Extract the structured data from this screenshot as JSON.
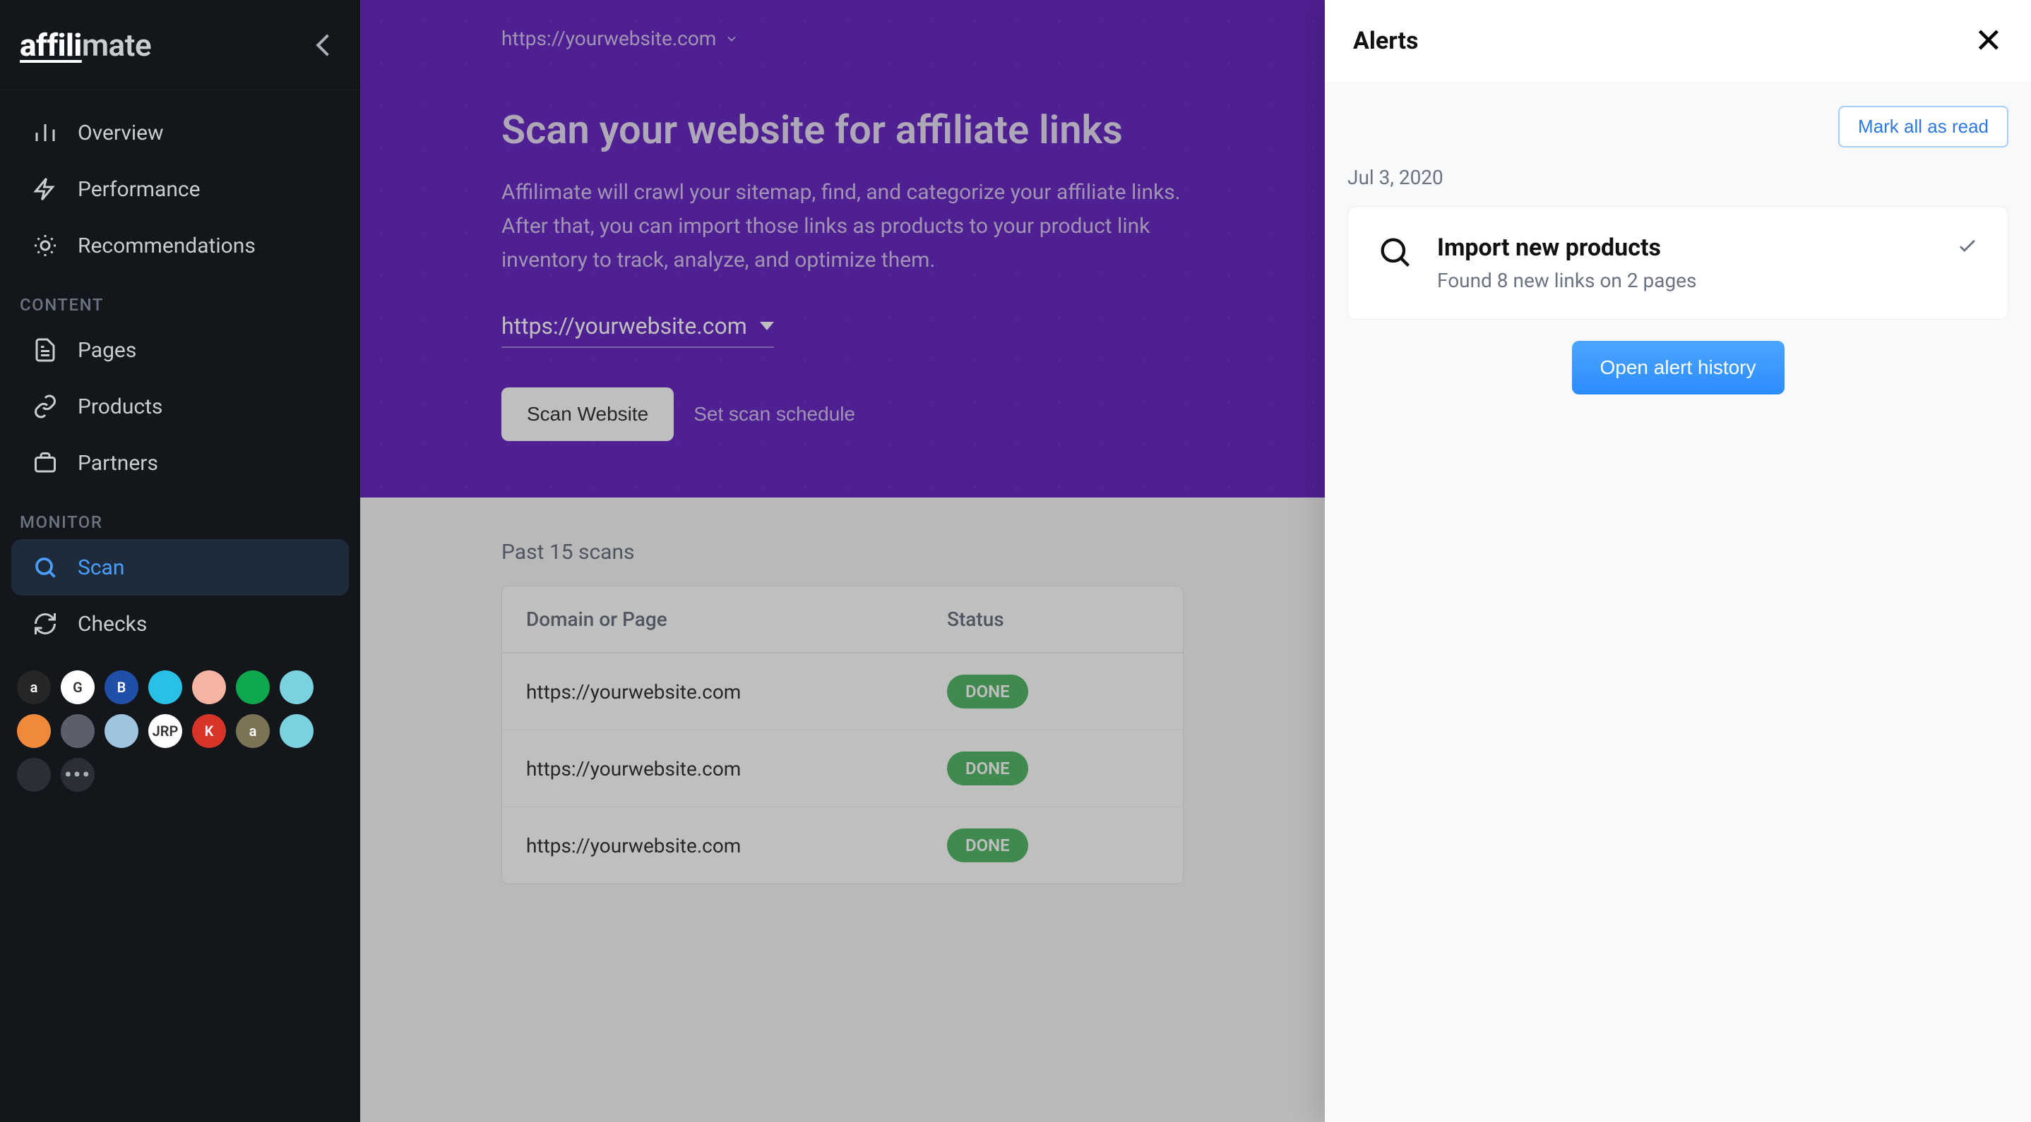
{
  "brand": {
    "part1": "affili",
    "part2": "mate"
  },
  "sidebar": {
    "items": [
      {
        "label": "Overview"
      },
      {
        "label": "Performance"
      },
      {
        "label": "Recommendations"
      }
    ],
    "sections": {
      "content": {
        "title": "CONTENT",
        "items": [
          {
            "label": "Pages"
          },
          {
            "label": "Products"
          },
          {
            "label": "Partners"
          }
        ]
      },
      "monitor": {
        "title": "MONITOR",
        "items": [
          {
            "label": "Scan"
          },
          {
            "label": "Checks"
          }
        ]
      }
    },
    "partner_badges": [
      {
        "initial": "a",
        "bg": "#262626"
      },
      {
        "initial": "G",
        "bg": "#ffffff"
      },
      {
        "initial": "B",
        "bg": "#1f4fa8"
      },
      {
        "initial": "",
        "bg": "#29c0e7"
      },
      {
        "initial": "",
        "bg": "#f5b4a4"
      },
      {
        "initial": "",
        "bg": "#0ea84f"
      },
      {
        "initial": "",
        "bg": "#7cd1e0"
      },
      {
        "initial": "",
        "bg": "#f08a3a"
      },
      {
        "initial": "",
        "bg": "#5a5f6b"
      },
      {
        "initial": "",
        "bg": "#9fc4e0"
      },
      {
        "initial": "JRP",
        "bg": "#ffffff"
      },
      {
        "initial": "K",
        "bg": "#d8352a"
      },
      {
        "initial": "a",
        "bg": "#7c7255"
      },
      {
        "initial": "",
        "bg": "#7cd1e0"
      },
      {
        "initial": "",
        "bg": "#2a2f37"
      }
    ]
  },
  "hero": {
    "site_top": "https://yourwebsite.com",
    "title": "Scan your website for affiliate links",
    "description": "Affilimate will crawl your sitemap, find, and categorize your affiliate links. After that, you can import those links as products to your product link inventory to track, analyze, and optimize them.",
    "site_select": "https://yourwebsite.com",
    "scan_button": "Scan Website",
    "schedule_button": "Set scan schedule"
  },
  "scans": {
    "title": "Past 15 scans",
    "columns": {
      "domain": "Domain or Page",
      "status": "Status"
    },
    "rows": [
      {
        "domain": "https://yourwebsite.com",
        "status": "DONE"
      },
      {
        "domain": "https://yourwebsite.com",
        "status": "DONE"
      },
      {
        "domain": "https://yourwebsite.com",
        "status": "DONE"
      }
    ]
  },
  "alerts": {
    "title": "Alerts",
    "mark_all": "Mark all as read",
    "date": "Jul 3, 2020",
    "card": {
      "title": "Import new products",
      "subtitle": "Found 8 new links on 2 pages"
    },
    "open_history": "Open alert history"
  }
}
